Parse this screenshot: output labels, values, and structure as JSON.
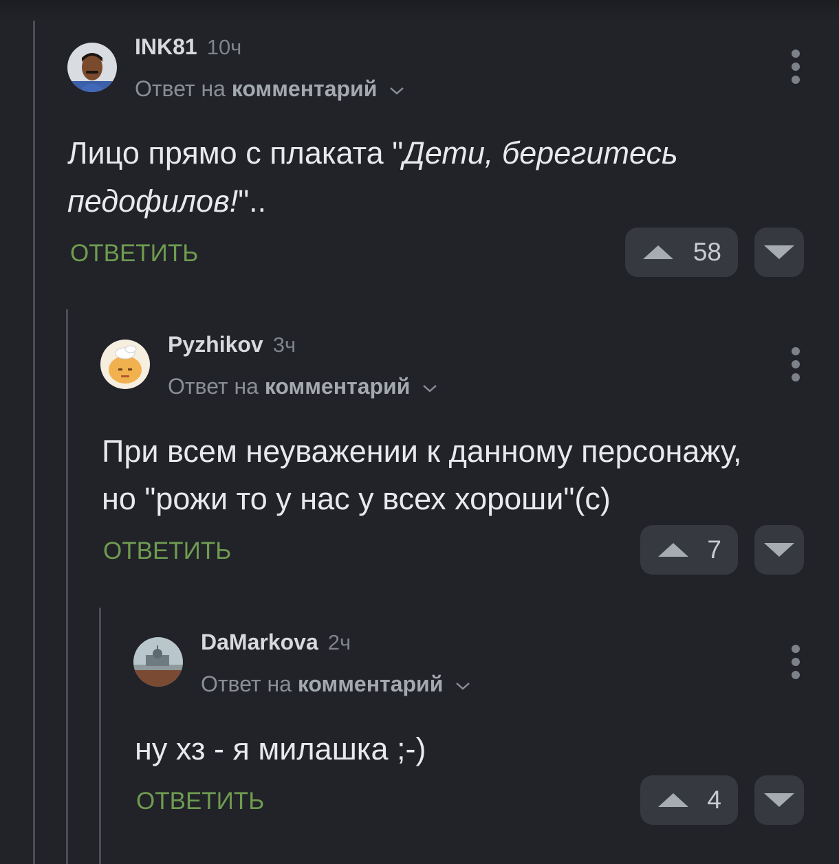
{
  "comments": [
    {
      "username": "INK81",
      "time": "10ч",
      "reply_prefix": "Ответ на",
      "reply_target": "комментарий",
      "text_line1_plain": "Лицо прямо с плаката \"",
      "text_line1_italic": "Дети, берегитесь",
      "text_line2_italic": "педофилов!",
      "text_line2_plain": "\"..",
      "reply_label": "ОТВЕТИТЬ",
      "rating": "58",
      "avatar_icon": "user-photo-avatar"
    },
    {
      "username": "Pyzhikov",
      "time": "3ч",
      "reply_prefix": "Ответ на",
      "reply_target": "комментарий",
      "text_line1": "При всем неуважении к данному персонажу,",
      "text_line2": "но \"рожи то у нас у всех хороши\"(с)",
      "reply_label": "ОТВЕТИТЬ",
      "rating": "7",
      "avatar_icon": "cartoon-avatar"
    },
    {
      "username": "DaMarkova",
      "time": "2ч",
      "reply_prefix": "Ответ на",
      "reply_target": "комментарий",
      "text_line1": "ну хз - я милашка ;-)",
      "reply_label": "ОТВЕТИТЬ",
      "rating": "4",
      "avatar_icon": "landscape-avatar"
    }
  ],
  "icons": {
    "more": "more-vertical-icon",
    "chevron": "chevron-down-icon",
    "upvote": "upvote-triangle-icon",
    "downvote": "downvote-triangle-icon"
  },
  "colors": {
    "background": "#212329",
    "reply_button": "#6f9c50",
    "vote_bg": "#36393f"
  }
}
